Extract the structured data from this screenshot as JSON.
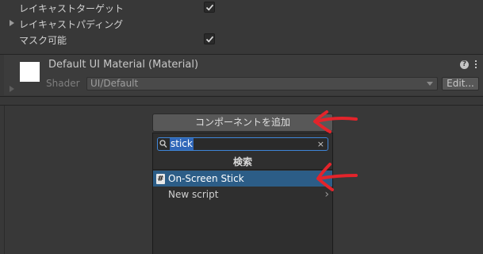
{
  "properties": [
    {
      "label": "レイキャストターゲット",
      "checked": true,
      "foldout": false
    },
    {
      "label": "レイキャストパディング",
      "checked": false,
      "foldout": true
    },
    {
      "label": "マスク可能",
      "checked": true,
      "foldout": false
    }
  ],
  "material": {
    "title": "Default UI Material (Material)",
    "shader_label": "Shader",
    "shader_value": "UI/Default",
    "edit_label": "Edit...",
    "help_glyph": "?"
  },
  "add_component": {
    "button_label": "コンポーネントを追加",
    "search_value": "stick",
    "clear_glyph": "×",
    "header": "検索",
    "items": [
      {
        "label": "On-Screen Stick",
        "icon": "script-hash-icon",
        "selected": true
      },
      {
        "label": "New script",
        "icon": "chevron-right-icon",
        "selected": false
      }
    ]
  },
  "colors": {
    "background": "#383838",
    "selection": "#2c5d87",
    "search_border": "#3f86d8",
    "annotation": "#e3242b"
  }
}
